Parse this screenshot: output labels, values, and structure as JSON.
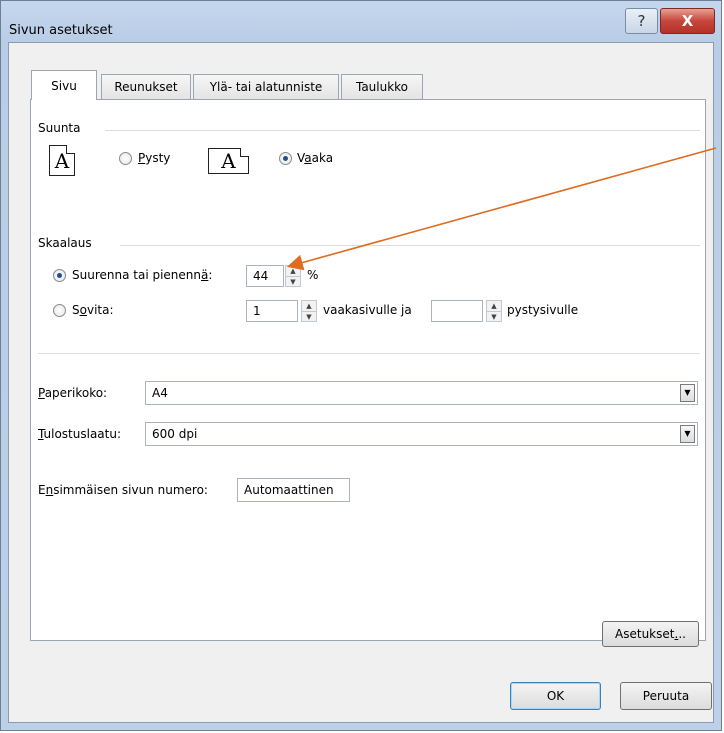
{
  "window": {
    "title": "Sivun asetukset",
    "help_glyph": "?",
    "close_glyph": "X"
  },
  "tabs": [
    {
      "label": "Sivu",
      "active": true
    },
    {
      "label": "Reunukset",
      "active": false
    },
    {
      "label": "Ylä- tai alatunniste",
      "active": false
    },
    {
      "label": "Taulukko",
      "active": false
    }
  ],
  "orientation": {
    "group_label": "Suunta",
    "page_icon_glyph": "A",
    "portrait": {
      "label": "Pysty",
      "selected": false
    },
    "landscape": {
      "label": "Vaaka",
      "selected": true
    }
  },
  "scaling": {
    "group_label": "Skaalaus",
    "adjust": {
      "label": "Suurenna tai pienennä:",
      "value": "44",
      "unit": "%",
      "selected": true
    },
    "fit": {
      "label": "Sovita:",
      "pages_wide": "1",
      "wide_label": "vaakasivulle ja",
      "pages_tall": "",
      "tall_label": "pystysivulle",
      "selected": false
    }
  },
  "paper_size": {
    "label": "Paperikoko:",
    "value": "A4"
  },
  "print_quality": {
    "label": "Tulostuslaatu:",
    "value": "600 dpi"
  },
  "first_page_number": {
    "label": "Ensimmäisen sivun numero:",
    "value": "Automaattinen"
  },
  "buttons": {
    "options": "Asetukset...",
    "ok": "OK",
    "cancel": "Peruuta"
  },
  "colors": {
    "accent_arrow": "#e06a1e",
    "close": "#c7453a",
    "title_bar": "#c4d7ee"
  }
}
